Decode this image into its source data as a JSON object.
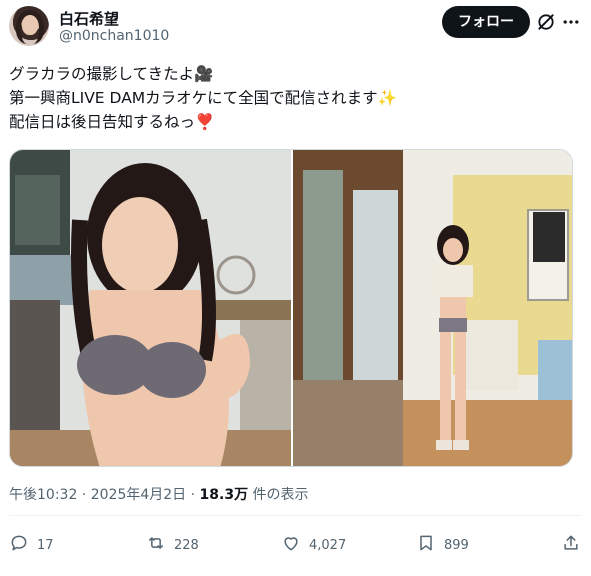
{
  "author": {
    "display_name": "白石希望",
    "handle": "@n0nchan1010",
    "avatar_icon": "profile-photo"
  },
  "header": {
    "follow_label": "フォロー",
    "grok_icon": "grok-icon",
    "more_icon": "more-icon"
  },
  "tweet": {
    "lines": [
      "グラカラの撮影してきたよ🎥",
      "第一興商LIVE DAMカラオケにて全国で配信されます✨",
      "配信日は後日告知するねっ❣️"
    ]
  },
  "media": {
    "photos": [
      {
        "alt": "photo-1"
      },
      {
        "alt": "photo-2"
      }
    ]
  },
  "meta": {
    "time": "午後10:32",
    "separator": " · ",
    "date": "2025年4月2日",
    "views_count": "18.3万",
    "views_label": " 件の表示"
  },
  "actions": {
    "reply_count": "17",
    "retweet_count": "228",
    "like_count": "4,027",
    "bookmark_count": "899"
  },
  "colors": {
    "text": "#0f1419",
    "muted": "#536471",
    "border": "#cfd9de",
    "follow_bg": "#0f1419"
  }
}
